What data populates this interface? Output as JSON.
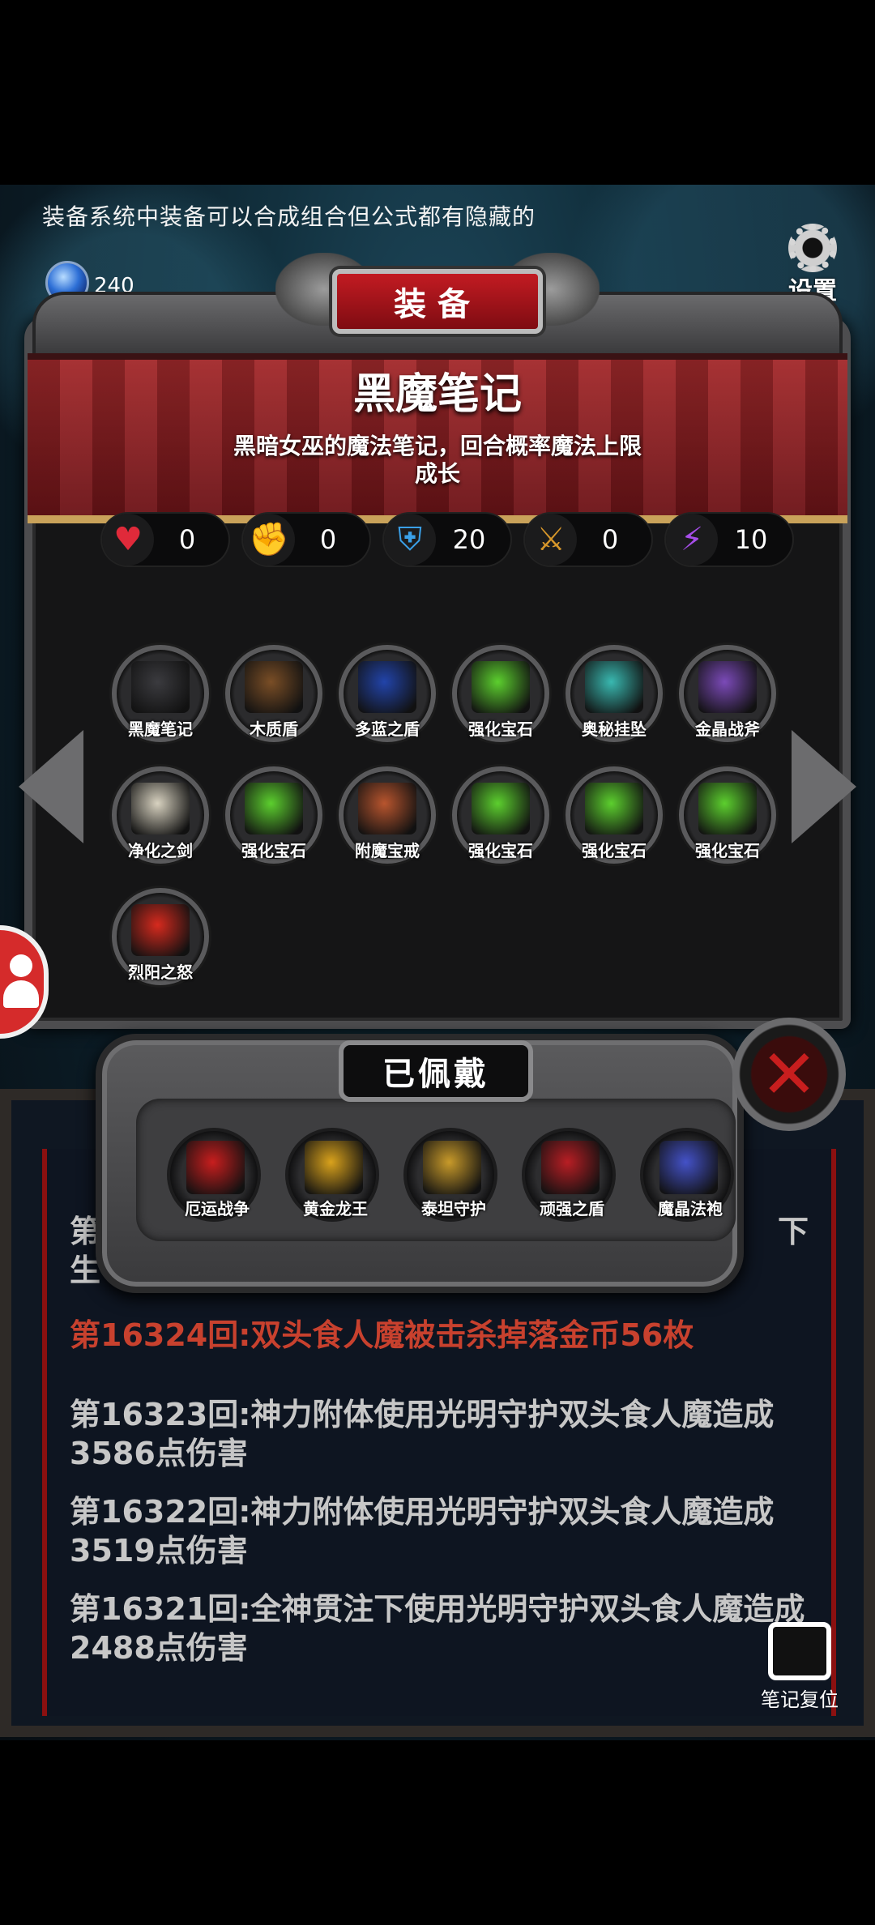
{
  "hint": "装备系统中装备可以合成组合但公式都有隐藏的",
  "crystal_count": "240",
  "settings_label": "设置",
  "panel_title": "装备",
  "selected_item": {
    "name": "黑魔笔记",
    "description": "黑暗女巫的魔法笔记，回合概率魔法上限成长"
  },
  "stats": [
    {
      "icon": "heart-icon",
      "value": "0",
      "color": "#e02a3a"
    },
    {
      "icon": "strength-icon",
      "value": "0",
      "color": "#e8c21a"
    },
    {
      "icon": "armor-icon",
      "value": "20",
      "color": "#3aa0e8"
    },
    {
      "icon": "attack-icon",
      "value": "0",
      "color": "#d6962a"
    },
    {
      "icon": "lightning-icon",
      "value": "10",
      "color": "#a64de8"
    }
  ],
  "inventory": [
    {
      "label": "黑魔笔记",
      "color": "#3b3b3f"
    },
    {
      "label": "木质盾",
      "color": "#7a4e26"
    },
    {
      "label": "多蓝之盾",
      "color": "#2244aa"
    },
    {
      "label": "强化宝石",
      "color": "#5ccf2e"
    },
    {
      "label": "奥秘挂坠",
      "color": "#39b8b0"
    },
    {
      "label": "金晶战斧",
      "color": "#7b4ab8"
    },
    {
      "label": "净化之剑",
      "color": "#d8d2c0"
    },
    {
      "label": "强化宝石",
      "color": "#5ccf2e"
    },
    {
      "label": "附魔宝戒",
      "color": "#b8552e"
    },
    {
      "label": "强化宝石",
      "color": "#5ccf2e"
    },
    {
      "label": "强化宝石",
      "color": "#5ccf2e"
    },
    {
      "label": "强化宝石",
      "color": "#5ccf2e"
    },
    {
      "label": "烈阳之怒",
      "color": "#d62a1e"
    }
  ],
  "equipped_title": "已佩戴",
  "equipped": [
    {
      "label": "厄运战争",
      "color": "#c81e1e"
    },
    {
      "label": "黄金龙王",
      "color": "#d9a21c"
    },
    {
      "label": "泰坦守护",
      "color": "#c89a2a"
    },
    {
      "label": "顽强之盾",
      "color": "#b81e24"
    },
    {
      "label": "魔晶法袍",
      "color": "#4452c8"
    }
  ],
  "log": {
    "partial_first_a": "第",
    "partial_first_b": "生",
    "partial_first_c": "下",
    "lines": [
      "第16324回:双头食人魔被击杀掉落金币56枚",
      "第16323回:神力附体使用光明守护双头食人魔造成3586点伤害",
      "第16322回:神力附体使用光明守护双头食人魔造成3519点伤害",
      "第16321回:全神贯注下使用光明守护双头食人魔造成2488点伤害"
    ]
  },
  "notes_reset_label": "笔记复位"
}
